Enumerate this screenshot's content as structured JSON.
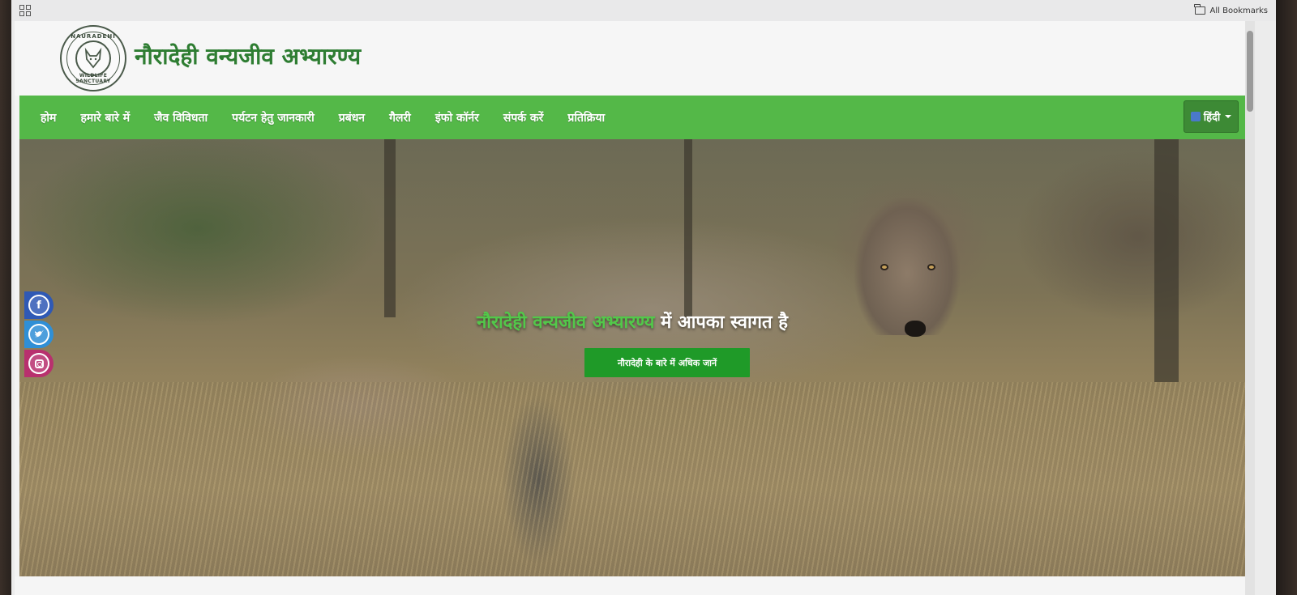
{
  "browser": {
    "bookmarks_label": "All Bookmarks"
  },
  "site": {
    "title": "नौरादेही वन्यजीव अभ्यारण्य",
    "logo_top_text": "NAURADEHI",
    "logo_bottom_text": "WILDLIFE SANCTUARY"
  },
  "nav": {
    "items": [
      {
        "label": "होम"
      },
      {
        "label": "हमारे बारे में"
      },
      {
        "label": "जैव विविधता"
      },
      {
        "label": "पर्यटन हेतु जानकारी"
      },
      {
        "label": "प्रबंधन"
      },
      {
        "label": "गैलरी"
      },
      {
        "label": "इंफो कॉर्नर"
      },
      {
        "label": "संपर्क करें"
      },
      {
        "label": "प्रतिक्रिया"
      }
    ],
    "language": "हिंदी"
  },
  "hero": {
    "heading_green": "नौरादेही वन्यजीव अभ्यारण्य",
    "heading_white": "में आपका स्वागत है",
    "button_label": "नौरादेही के बारे में अधिक जानें"
  },
  "social": {
    "facebook_glyph": "f",
    "twitter_glyph": "t"
  },
  "colors": {
    "nav_green": "#54b848",
    "title_green": "#2e7d32",
    "button_green": "#1f9a28",
    "facebook": "#2f59b5",
    "twitter": "#2f8fd6",
    "instagram": "#b8306e"
  }
}
